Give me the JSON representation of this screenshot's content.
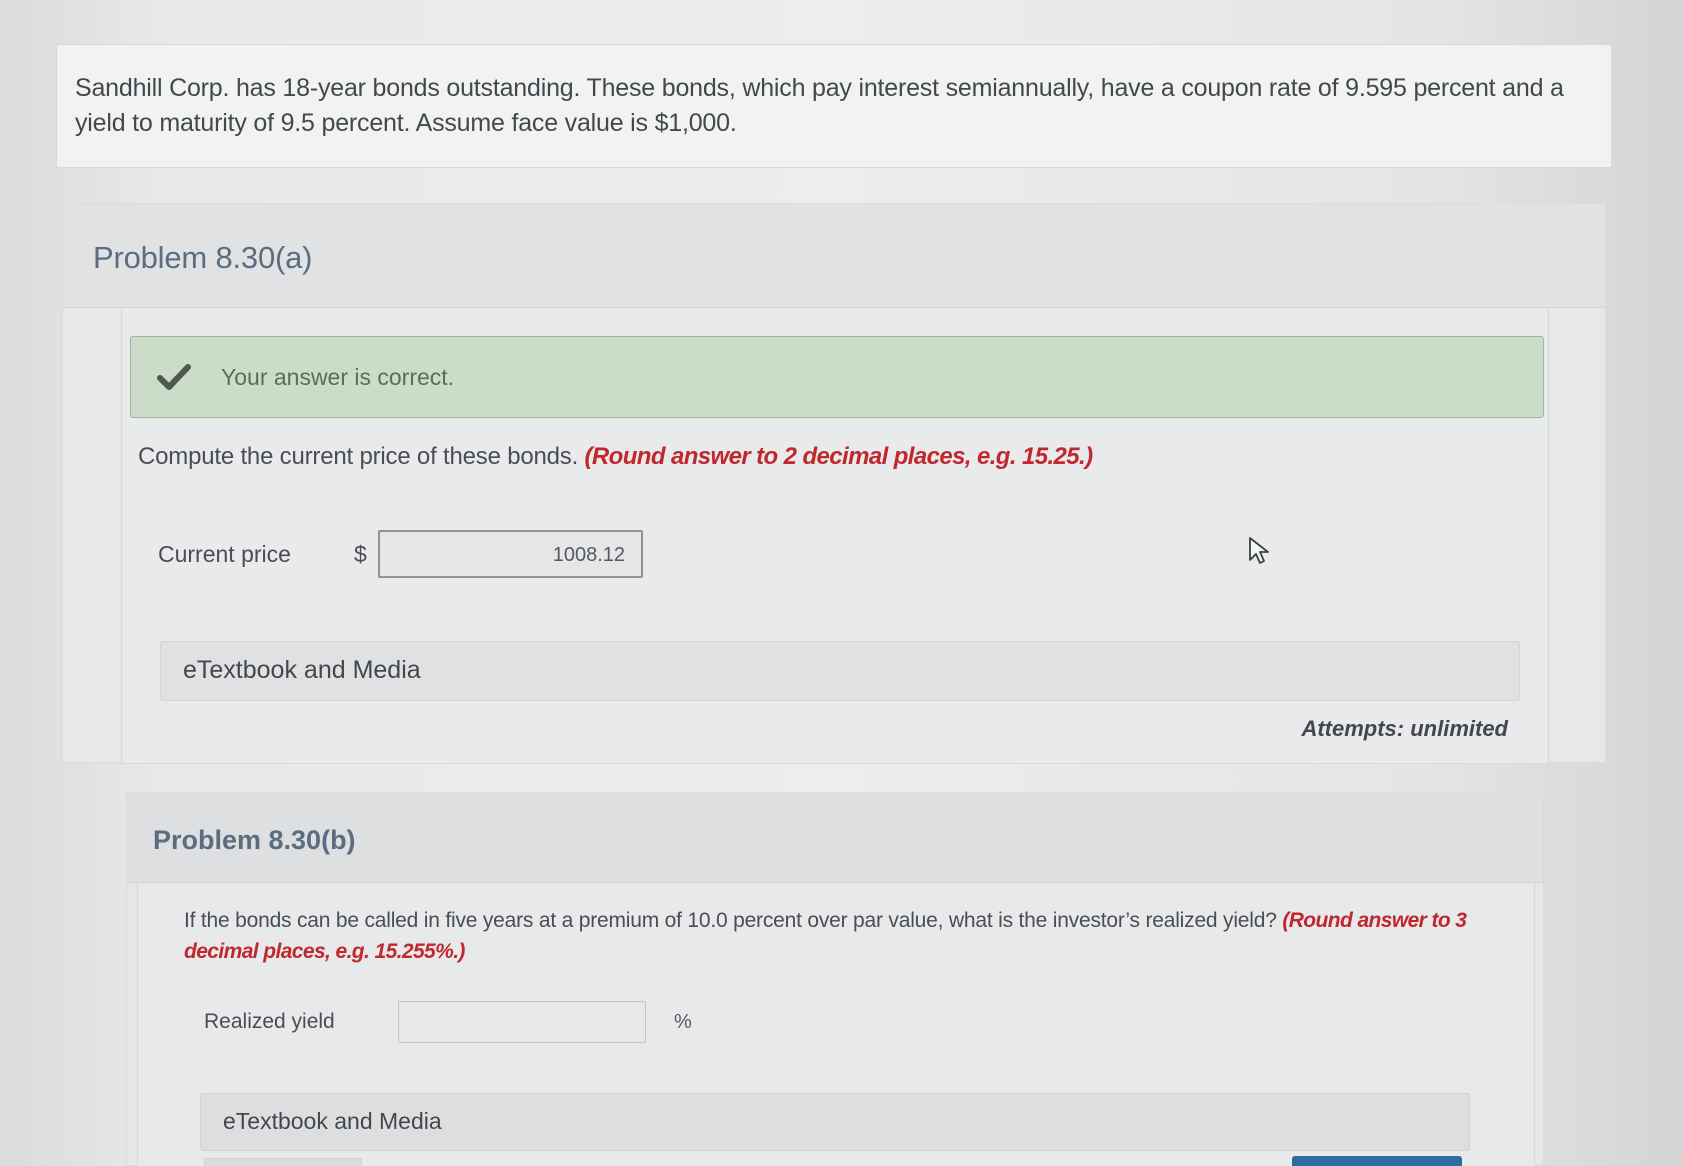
{
  "question": {
    "text": "Sandhill Corp. has 18-year bonds outstanding. These bonds, which pay interest semiannually, have a coupon rate of 9.595 percent and a yield to maturity of 9.5 percent. Assume face value is $1,000."
  },
  "part_a": {
    "title": "Problem 8.30(a)",
    "banner": {
      "icon": "check-icon",
      "text": "Your answer is correct.",
      "color": "#cbdcc9"
    },
    "instruction": "Compute the current price of these bonds.",
    "hint": "(Round answer to 2 decimal places, e.g. 15.25.)",
    "field_label": "Current price",
    "currency": "$",
    "answer_value": "1008.12",
    "etext_label": "eTextbook and Media",
    "attempts": "Attempts: unlimited"
  },
  "part_b": {
    "title": "Problem 8.30(b)",
    "instruction": "If the bonds can be called in five years at a premium of 10.0 percent over par value, what is the investor’s realized yield?",
    "hint": "(Round answer to 3 decimal places, e.g. 15.255%.)",
    "field_label": "Realized yield",
    "answer_value": "",
    "unit": "%",
    "etext_label": "eTextbook and Media"
  },
  "colors": {
    "hint_red": "#c0282d",
    "title_blue": "#5b6d80",
    "submit_blue": "#2e6da4"
  }
}
